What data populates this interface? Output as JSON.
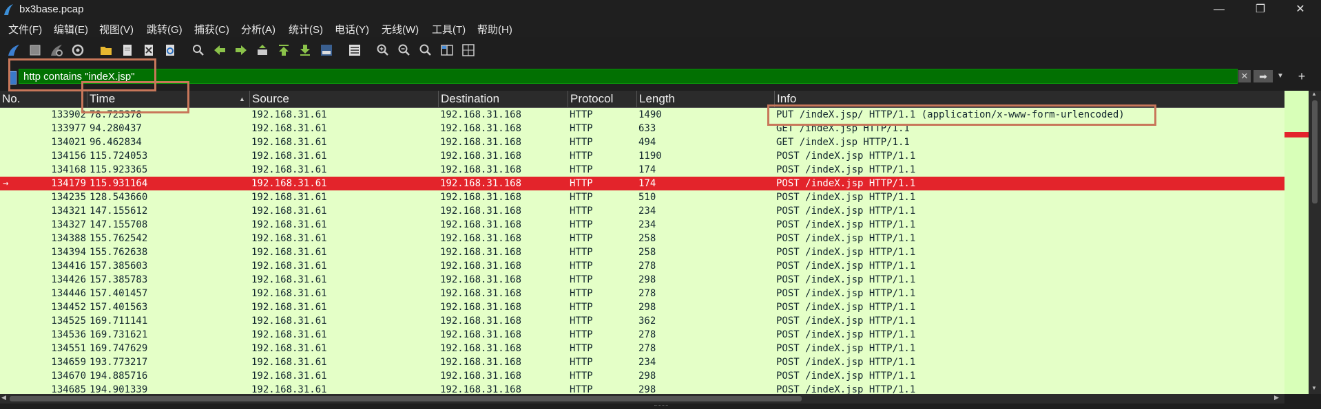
{
  "window": {
    "title": "bx3base.pcap",
    "minimize": "—",
    "maximize": "❐",
    "close": "✕"
  },
  "menu": [
    {
      "label": "文件(F)"
    },
    {
      "label": "编辑(E)"
    },
    {
      "label": "视图(V)"
    },
    {
      "label": "跳转(G)"
    },
    {
      "label": "捕获(C)"
    },
    {
      "label": "分析(A)"
    },
    {
      "label": "统计(S)"
    },
    {
      "label": "电话(Y)"
    },
    {
      "label": "无线(W)"
    },
    {
      "label": "工具(T)"
    },
    {
      "label": "帮助(H)"
    }
  ],
  "toolbar": {
    "icons": [
      "shark-fin-start-icon",
      "stop-square-icon",
      "shark-fin-restart-icon",
      "capture-options-gear-icon",
      "open-folder-icon",
      "file-icon",
      "close-file-icon",
      "reload-icon",
      "find-magnifier-icon",
      "go-back-arrow-icon",
      "go-forward-arrow-icon",
      "go-to-packet-icon",
      "first-packet-icon",
      "last-packet-icon",
      "auto-scroll-icon",
      "colorize-icon",
      "zoom-in-icon",
      "zoom-out-icon",
      "zoom-normal-icon",
      "resize-columns-icon",
      "layout-icon"
    ]
  },
  "filter": {
    "value": "http contains \"indeX.jsp\"",
    "clear": "✕",
    "apply": "➡",
    "dropdown": "▼",
    "add": "+"
  },
  "columns": {
    "no": "No.",
    "time": "Time",
    "source": "Source",
    "destination": "Destination",
    "protocol": "Protocol",
    "length": "Length",
    "info": "Info",
    "sort_indicator": "▲"
  },
  "rows": [
    {
      "no": "133902",
      "time": "78.725378",
      "src": "192.168.31.61",
      "dst": "192.168.31.168",
      "proto": "HTTP",
      "len": "1490",
      "info": "PUT /indeX.jsp/ HTTP/1.1  (application/x-www-form-urlencoded)"
    },
    {
      "no": "133977",
      "time": "94.280437",
      "src": "192.168.31.61",
      "dst": "192.168.31.168",
      "proto": "HTTP",
      "len": "633",
      "info": "GET /indeX.jsp HTTP/1.1"
    },
    {
      "no": "134021",
      "time": "96.462834",
      "src": "192.168.31.61",
      "dst": "192.168.31.168",
      "proto": "HTTP",
      "len": "494",
      "info": "GET /indeX.jsp HTTP/1.1"
    },
    {
      "no": "134156",
      "time": "115.724053",
      "src": "192.168.31.61",
      "dst": "192.168.31.168",
      "proto": "HTTP",
      "len": "1190",
      "info": "POST /indeX.jsp HTTP/1.1"
    },
    {
      "no": "134168",
      "time": "115.923365",
      "src": "192.168.31.61",
      "dst": "192.168.31.168",
      "proto": "HTTP",
      "len": "174",
      "info": "POST /indeX.jsp HTTP/1.1"
    },
    {
      "no": "134179",
      "time": "115.931164",
      "src": "192.168.31.61",
      "dst": "192.168.31.168",
      "proto": "HTTP",
      "len": "174",
      "info": "POST /indeX.jsp HTTP/1.1",
      "selected": true,
      "marker": "→"
    },
    {
      "no": "134235",
      "time": "128.543660",
      "src": "192.168.31.61",
      "dst": "192.168.31.168",
      "proto": "HTTP",
      "len": "510",
      "info": "POST /indeX.jsp HTTP/1.1"
    },
    {
      "no": "134321",
      "time": "147.155612",
      "src": "192.168.31.61",
      "dst": "192.168.31.168",
      "proto": "HTTP",
      "len": "234",
      "info": "POST /indeX.jsp HTTP/1.1"
    },
    {
      "no": "134327",
      "time": "147.155708",
      "src": "192.168.31.61",
      "dst": "192.168.31.168",
      "proto": "HTTP",
      "len": "234",
      "info": "POST /indeX.jsp HTTP/1.1"
    },
    {
      "no": "134388",
      "time": "155.762542",
      "src": "192.168.31.61",
      "dst": "192.168.31.168",
      "proto": "HTTP",
      "len": "258",
      "info": "POST /indeX.jsp HTTP/1.1"
    },
    {
      "no": "134394",
      "time": "155.762638",
      "src": "192.168.31.61",
      "dst": "192.168.31.168",
      "proto": "HTTP",
      "len": "258",
      "info": "POST /indeX.jsp HTTP/1.1"
    },
    {
      "no": "134416",
      "time": "157.385603",
      "src": "192.168.31.61",
      "dst": "192.168.31.168",
      "proto": "HTTP",
      "len": "278",
      "info": "POST /indeX.jsp HTTP/1.1"
    },
    {
      "no": "134426",
      "time": "157.385783",
      "src": "192.168.31.61",
      "dst": "192.168.31.168",
      "proto": "HTTP",
      "len": "298",
      "info": "POST /indeX.jsp HTTP/1.1"
    },
    {
      "no": "134446",
      "time": "157.401457",
      "src": "192.168.31.61",
      "dst": "192.168.31.168",
      "proto": "HTTP",
      "len": "278",
      "info": "POST /indeX.jsp HTTP/1.1"
    },
    {
      "no": "134452",
      "time": "157.401563",
      "src": "192.168.31.61",
      "dst": "192.168.31.168",
      "proto": "HTTP",
      "len": "298",
      "info": "POST /indeX.jsp HTTP/1.1"
    },
    {
      "no": "134525",
      "time": "169.711141",
      "src": "192.168.31.61",
      "dst": "192.168.31.168",
      "proto": "HTTP",
      "len": "362",
      "info": "POST /indeX.jsp HTTP/1.1"
    },
    {
      "no": "134536",
      "time": "169.731621",
      "src": "192.168.31.61",
      "dst": "192.168.31.168",
      "proto": "HTTP",
      "len": "278",
      "info": "POST /indeX.jsp HTTP/1.1"
    },
    {
      "no": "134551",
      "time": "169.747629",
      "src": "192.168.31.61",
      "dst": "192.168.31.168",
      "proto": "HTTP",
      "len": "278",
      "info": "POST /indeX.jsp HTTP/1.1"
    },
    {
      "no": "134659",
      "time": "193.773217",
      "src": "192.168.31.61",
      "dst": "192.168.31.168",
      "proto": "HTTP",
      "len": "234",
      "info": "POST /indeX.jsp HTTP/1.1"
    },
    {
      "no": "134670",
      "time": "194.885716",
      "src": "192.168.31.61",
      "dst": "192.168.31.168",
      "proto": "HTTP",
      "len": "298",
      "info": "POST /indeX.jsp HTTP/1.1"
    },
    {
      "no": "134685",
      "time": "194.901339",
      "src": "192.168.31.61",
      "dst": "192.168.31.168",
      "proto": "HTTP",
      "len": "298",
      "info": "POST /indeX.jsp HTTP/1.1"
    }
  ],
  "colors": {
    "http_row_bg": "#e4ffc7",
    "selected_row_bg": "#e3242b",
    "filter_valid_bg": "#027002",
    "annotation": "#c8775a"
  }
}
